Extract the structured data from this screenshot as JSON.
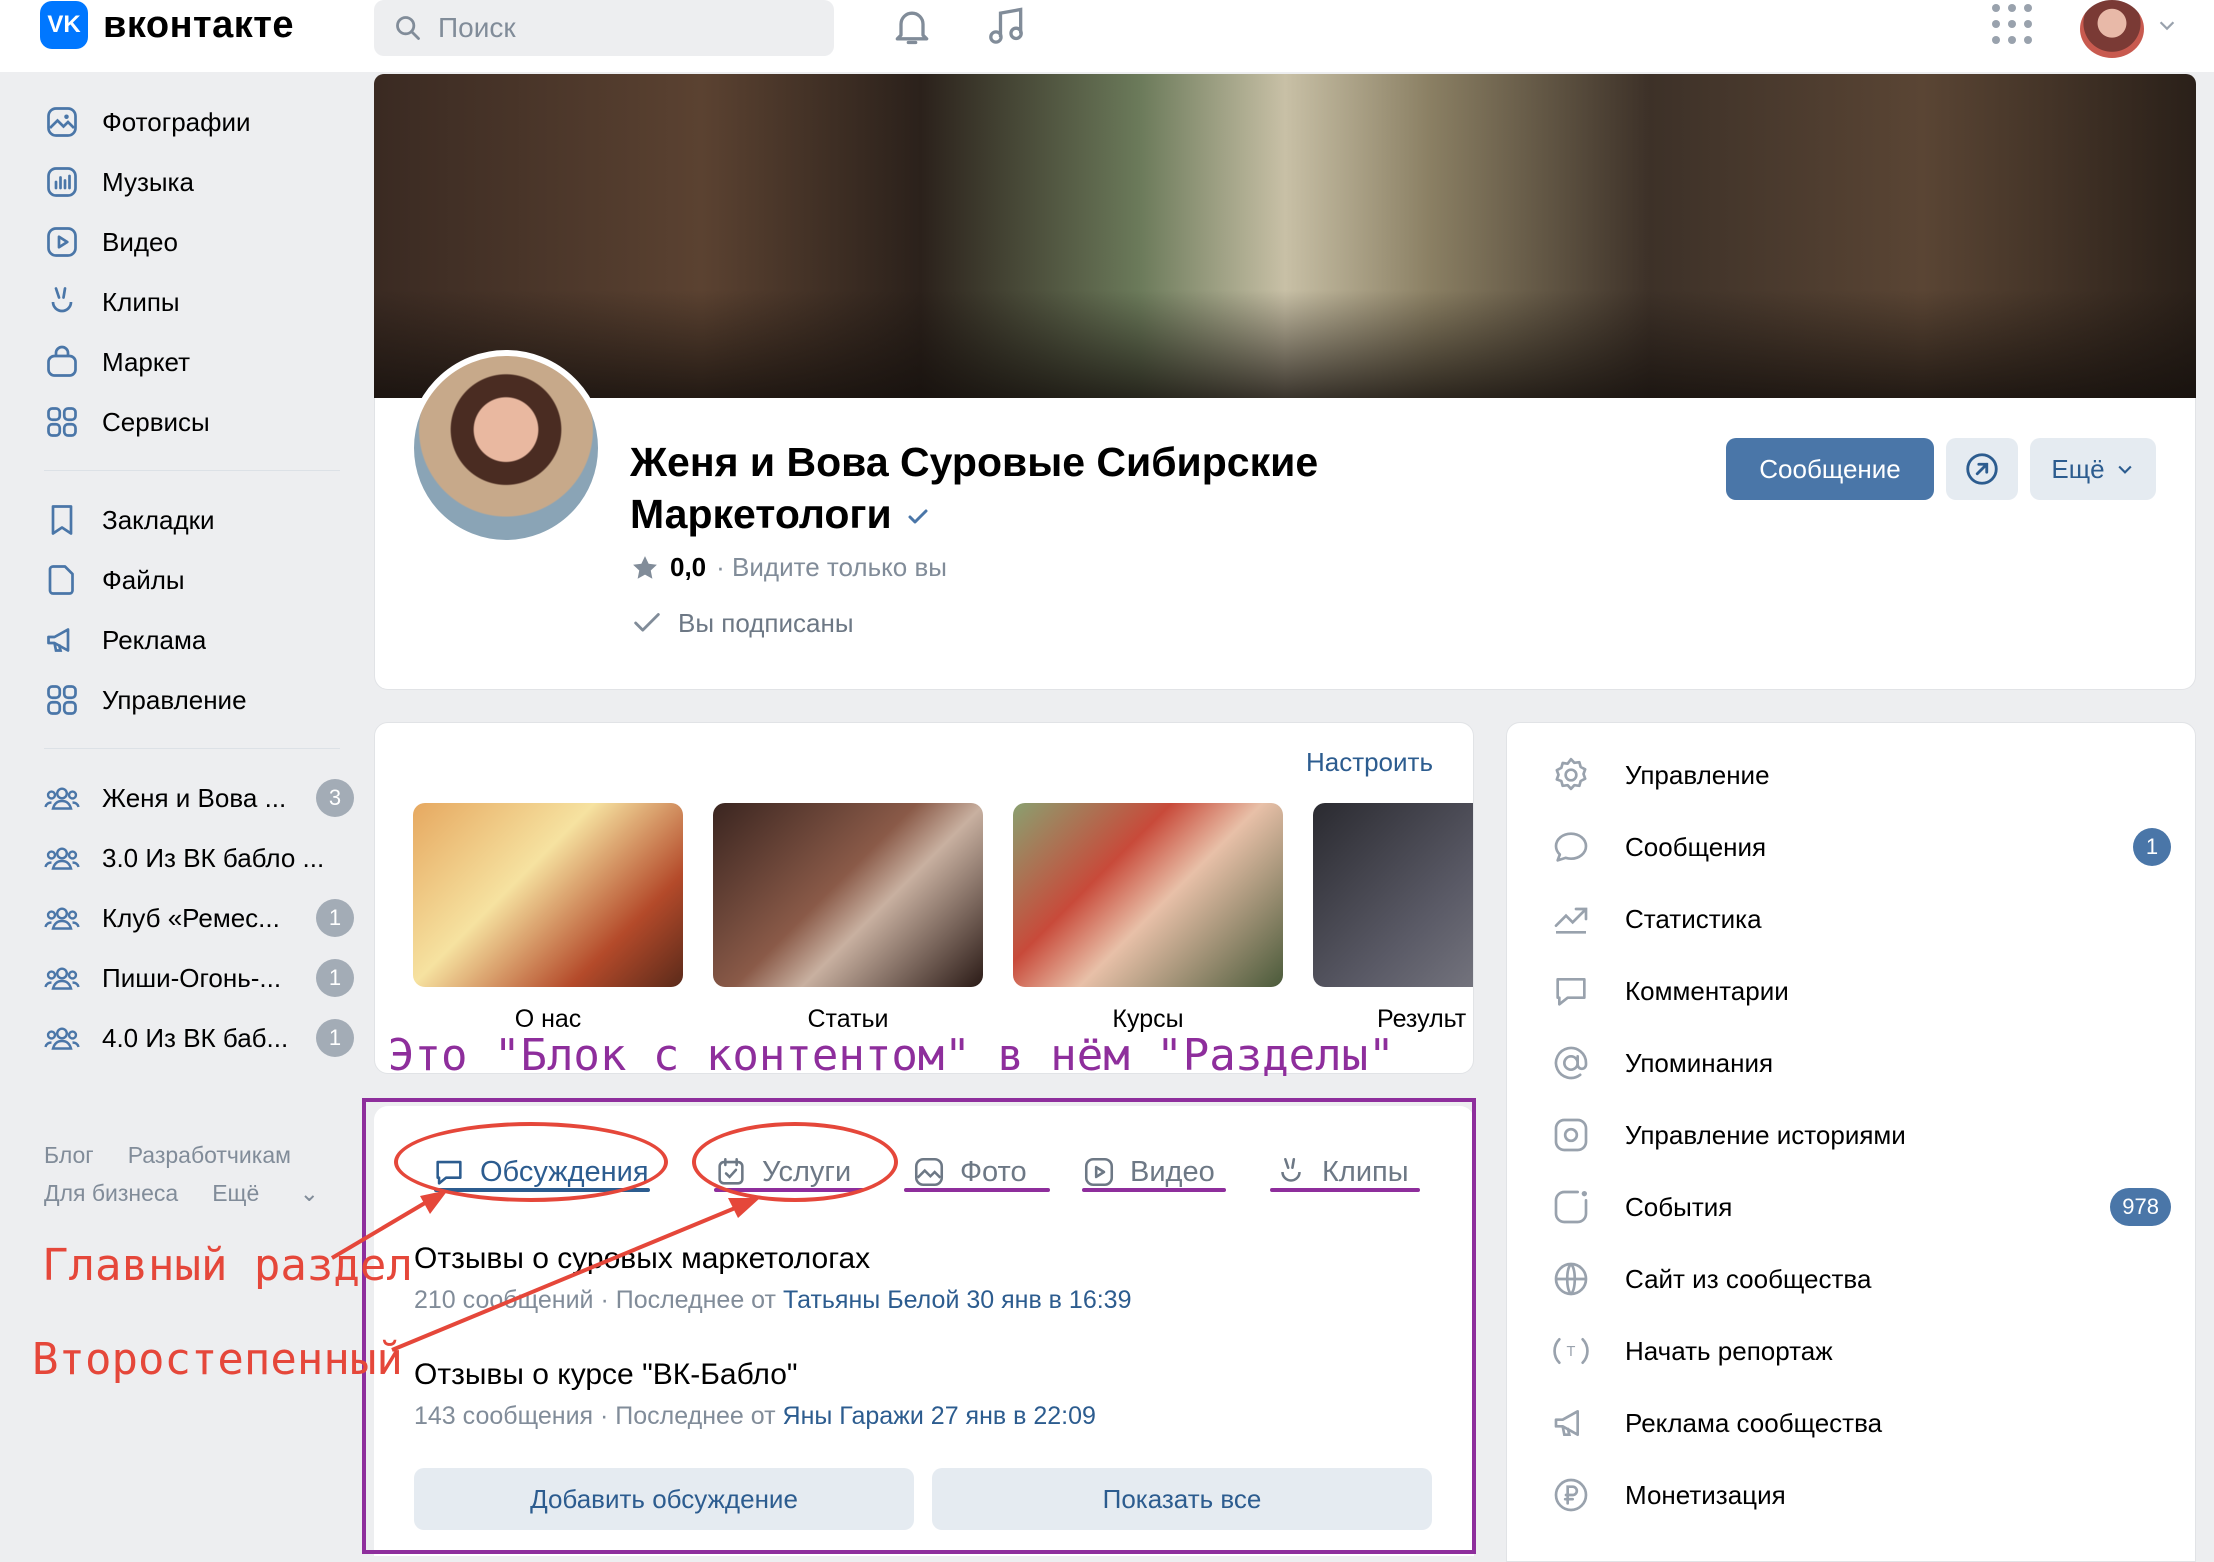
{
  "header": {
    "logo_mark": "VK",
    "logo_text": "вконтакте",
    "search_placeholder": "Поиск"
  },
  "sidebar": {
    "main_items": [
      {
        "label": "Фотографии",
        "icon": "photos-icon"
      },
      {
        "label": "Музыка",
        "icon": "music-icon"
      },
      {
        "label": "Видео",
        "icon": "video-icon"
      },
      {
        "label": "Клипы",
        "icon": "clips-icon"
      },
      {
        "label": "Маркет",
        "icon": "market-icon"
      },
      {
        "label": "Сервисы",
        "icon": "services-icon"
      }
    ],
    "secondary_items": [
      {
        "label": "Закладки",
        "icon": "bookmark-icon"
      },
      {
        "label": "Файлы",
        "icon": "file-icon"
      },
      {
        "label": "Реклама",
        "icon": "megaphone-icon"
      },
      {
        "label": "Управление",
        "icon": "manage-icon"
      }
    ],
    "groups": [
      {
        "label": "Женя и Вова ...",
        "badge": "3"
      },
      {
        "label": "3.0 Из ВК бабло ...",
        "badge": ""
      },
      {
        "label": "Клуб «Ремес...",
        "badge": "1"
      },
      {
        "label": "Пиши-Огонь-...",
        "badge": "1"
      },
      {
        "label": "4.0 Из ВК баб...",
        "badge": "1"
      }
    ],
    "footer": {
      "blog": "Блог",
      "developers": "Разработчикам",
      "business": "Для бизнеса",
      "more": "Ещё"
    }
  },
  "profile": {
    "name": "Женя и Вова Суровые Сибирские Маркетологи",
    "rating": "0,0",
    "rating_note": "· Видите только вы",
    "subscribed": "Вы подписаны",
    "message_button": "Сообщение",
    "more_button": "Ещё"
  },
  "content_block": {
    "configure": "Настроить",
    "sections": [
      {
        "label": "О нас",
        "color": "#c9763a"
      },
      {
        "label": "Статьи",
        "color": "#7a4a3a"
      },
      {
        "label": "Курсы",
        "color": "#a64a3a"
      },
      {
        "label": "Результ",
        "color": "#4a4a52"
      }
    ],
    "annotation": "Это \"Блок с контентом\" в нём \"Разделы\""
  },
  "discussions": {
    "tabs": [
      {
        "label": "Обсуждения",
        "icon": "chat-icon"
      },
      {
        "label": "Услуги",
        "icon": "services-check-icon"
      },
      {
        "label": "Фото",
        "icon": "photo-icon"
      },
      {
        "label": "Видео",
        "icon": "video-icon"
      },
      {
        "label": "Клипы",
        "icon": "clips-icon"
      }
    ],
    "topics": [
      {
        "title": "Отзывы о суровых маркетологах",
        "count": "210 сообщений",
        "last_prefix": "· Последнее от",
        "author": "Татьяны Белой",
        "date": "30 янв в 16:39"
      },
      {
        "title": "Отзывы о курсе \"ВК-Бабло\"",
        "count": "143 сообщения",
        "last_prefix": "· Последнее от",
        "author": "Яны Гаражи",
        "date": "27 янв в 22:09"
      }
    ],
    "add_button": "Добавить обсуждение",
    "show_all_button": "Показать все"
  },
  "annotations": {
    "main_section": "Главный раздел",
    "secondary": "Второстепенный"
  },
  "right_menu": [
    {
      "label": "Управление",
      "icon": "gear-icon",
      "badge": ""
    },
    {
      "label": "Сообщения",
      "icon": "message-icon",
      "badge": "1"
    },
    {
      "label": "Статистика",
      "icon": "stats-icon",
      "badge": ""
    },
    {
      "label": "Комментарии",
      "icon": "comment-icon",
      "badge": ""
    },
    {
      "label": "Упоминания",
      "icon": "mention-icon",
      "badge": ""
    },
    {
      "label": "Управление историями",
      "icon": "stories-icon",
      "badge": ""
    },
    {
      "label": "События",
      "icon": "events-icon",
      "badge": "978"
    },
    {
      "label": "Сайт из сообщества",
      "icon": "globe-icon",
      "badge": ""
    },
    {
      "label": "Начать репортаж",
      "icon": "live-icon",
      "badge": ""
    },
    {
      "label": "Реклама сообщества",
      "icon": "megaphone-icon",
      "badge": ""
    },
    {
      "label": "Монетизация",
      "icon": "ruble-icon",
      "badge": ""
    }
  ],
  "colors": {
    "accent": "#4a76a8",
    "link": "#2c5c8f",
    "annotation_purple": "#8e2e9c",
    "annotation_red": "#e5473a"
  }
}
